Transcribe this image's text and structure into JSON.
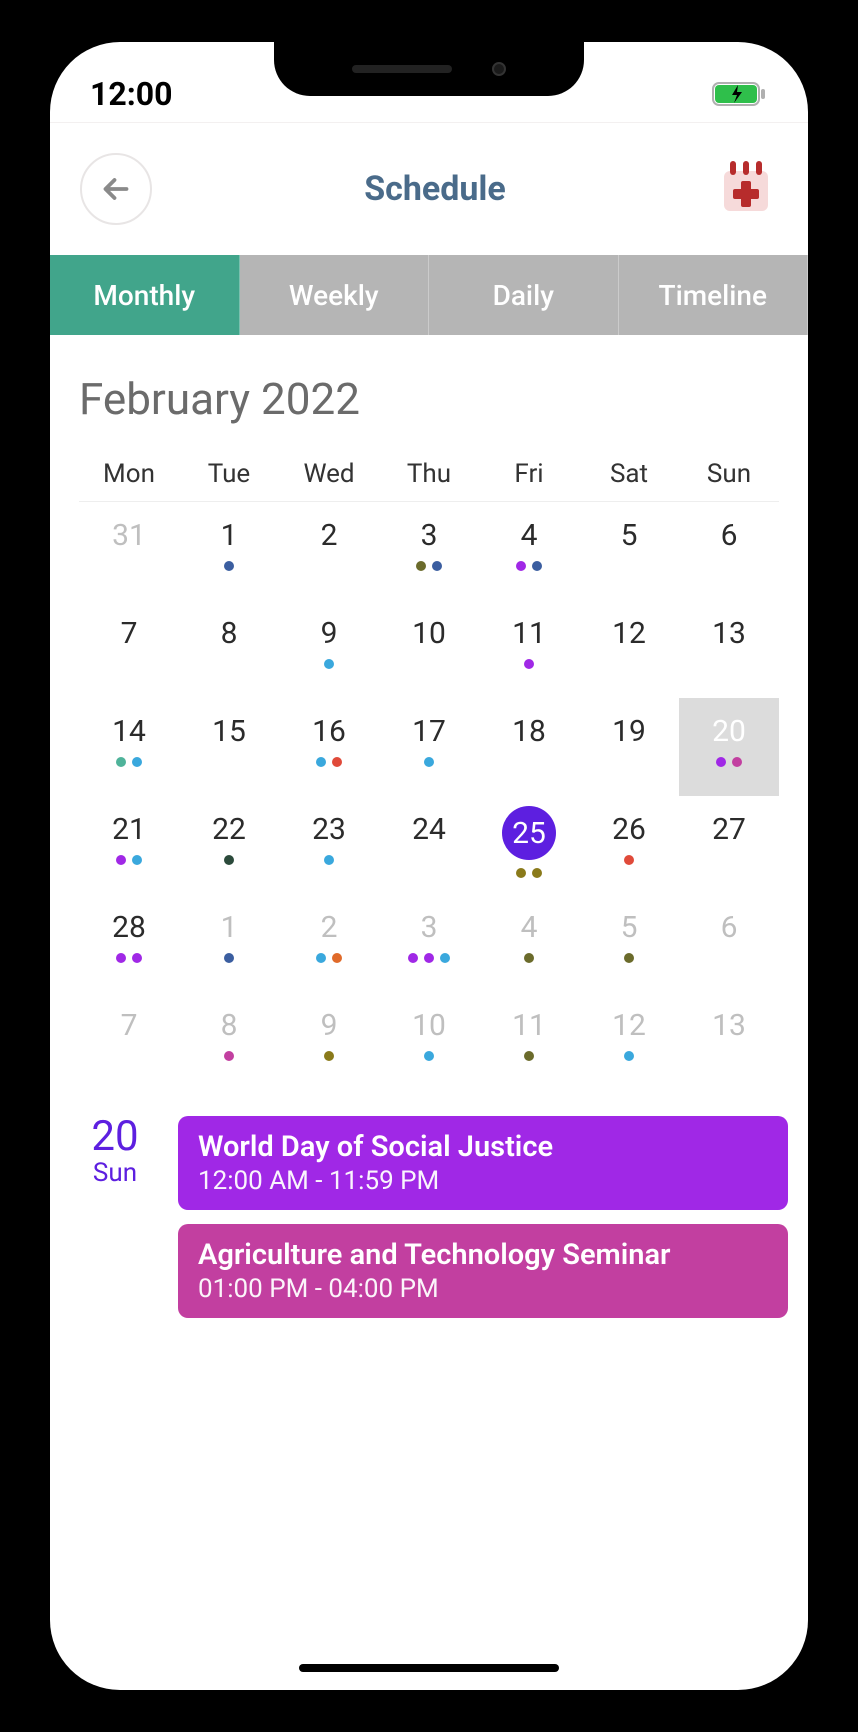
{
  "status": {
    "time": "12:00"
  },
  "header": {
    "title": "Schedule"
  },
  "tabs": [
    {
      "label": "Monthly",
      "active": true
    },
    {
      "label": "Weekly",
      "active": false
    },
    {
      "label": "Daily",
      "active": false
    },
    {
      "label": "Timeline",
      "active": false
    }
  ],
  "calendar": {
    "title": "February 2022",
    "weekdays": [
      "Mon",
      "Tue",
      "Wed",
      "Thu",
      "Fri",
      "Sat",
      "Sun"
    ],
    "days": [
      {
        "n": "31",
        "other": true,
        "dots": []
      },
      {
        "n": "1",
        "dots": [
          "#3b5ea0"
        ]
      },
      {
        "n": "2",
        "dots": []
      },
      {
        "n": "3",
        "dots": [
          "#6b6b2b",
          "#3b5ea0"
        ]
      },
      {
        "n": "4",
        "dots": [
          "#a028e6",
          "#3b5ea0"
        ]
      },
      {
        "n": "5",
        "dots": []
      },
      {
        "n": "6",
        "dots": []
      },
      {
        "n": "7",
        "dots": []
      },
      {
        "n": "8",
        "dots": []
      },
      {
        "n": "9",
        "dots": [
          "#3aa8dd"
        ]
      },
      {
        "n": "10",
        "dots": []
      },
      {
        "n": "11",
        "dots": [
          "#a028e6"
        ]
      },
      {
        "n": "12",
        "dots": []
      },
      {
        "n": "13",
        "dots": []
      },
      {
        "n": "14",
        "dots": [
          "#4fb39a",
          "#3aa8dd"
        ]
      },
      {
        "n": "15",
        "dots": []
      },
      {
        "n": "16",
        "dots": [
          "#3aa8dd",
          "#e04a3a"
        ]
      },
      {
        "n": "17",
        "dots": [
          "#3aa8dd"
        ]
      },
      {
        "n": "18",
        "dots": []
      },
      {
        "n": "19",
        "dots": []
      },
      {
        "n": "20",
        "today": true,
        "dots": [
          "#a028e6",
          "#c23fa0"
        ]
      },
      {
        "n": "21",
        "dots": [
          "#a028e6",
          "#3aa8dd"
        ]
      },
      {
        "n": "22",
        "dots": [
          "#2b4a3b"
        ]
      },
      {
        "n": "23",
        "dots": [
          "#3aa8dd"
        ]
      },
      {
        "n": "24",
        "dots": []
      },
      {
        "n": "25",
        "selected": true,
        "dots": [
          "#8a7a1a",
          "#8a7a1a"
        ]
      },
      {
        "n": "26",
        "dots": [
          "#e04a3a"
        ]
      },
      {
        "n": "27",
        "dots": []
      },
      {
        "n": "28",
        "dots": [
          "#a028e6",
          "#a028e6"
        ]
      },
      {
        "n": "1",
        "other": true,
        "dots": [
          "#3b5ea0"
        ]
      },
      {
        "n": "2",
        "other": true,
        "dots": [
          "#3aa8dd",
          "#e06a2a"
        ]
      },
      {
        "n": "3",
        "other": true,
        "dots": [
          "#a028e6",
          "#a028e6",
          "#3aa8dd"
        ]
      },
      {
        "n": "4",
        "other": true,
        "dots": [
          "#6b6b2b"
        ]
      },
      {
        "n": "5",
        "other": true,
        "dots": [
          "#6b6b2b"
        ]
      },
      {
        "n": "6",
        "other": true,
        "dots": []
      },
      {
        "n": "7",
        "other": true,
        "dots": []
      },
      {
        "n": "8",
        "other": true,
        "dots": [
          "#c23fa0"
        ]
      },
      {
        "n": "9",
        "other": true,
        "dots": [
          "#8a7a1a"
        ]
      },
      {
        "n": "10",
        "other": true,
        "dots": [
          "#3aa8dd"
        ]
      },
      {
        "n": "11",
        "other": true,
        "dots": [
          "#6b6b2b"
        ]
      },
      {
        "n": "12",
        "other": true,
        "dots": [
          "#3aa8dd"
        ]
      },
      {
        "n": "13",
        "other": true,
        "dots": []
      }
    ]
  },
  "eventsPanel": {
    "dateNum": "20",
    "dateName": "Sun",
    "events": [
      {
        "title": "World Day of Social Justice",
        "time": "12:00 AM - 11:59 PM",
        "color": "#a028e6"
      },
      {
        "title": "Agriculture and Technology Seminar",
        "time": "01:00 PM - 04:00 PM",
        "color": "#c23fa0"
      }
    ]
  }
}
